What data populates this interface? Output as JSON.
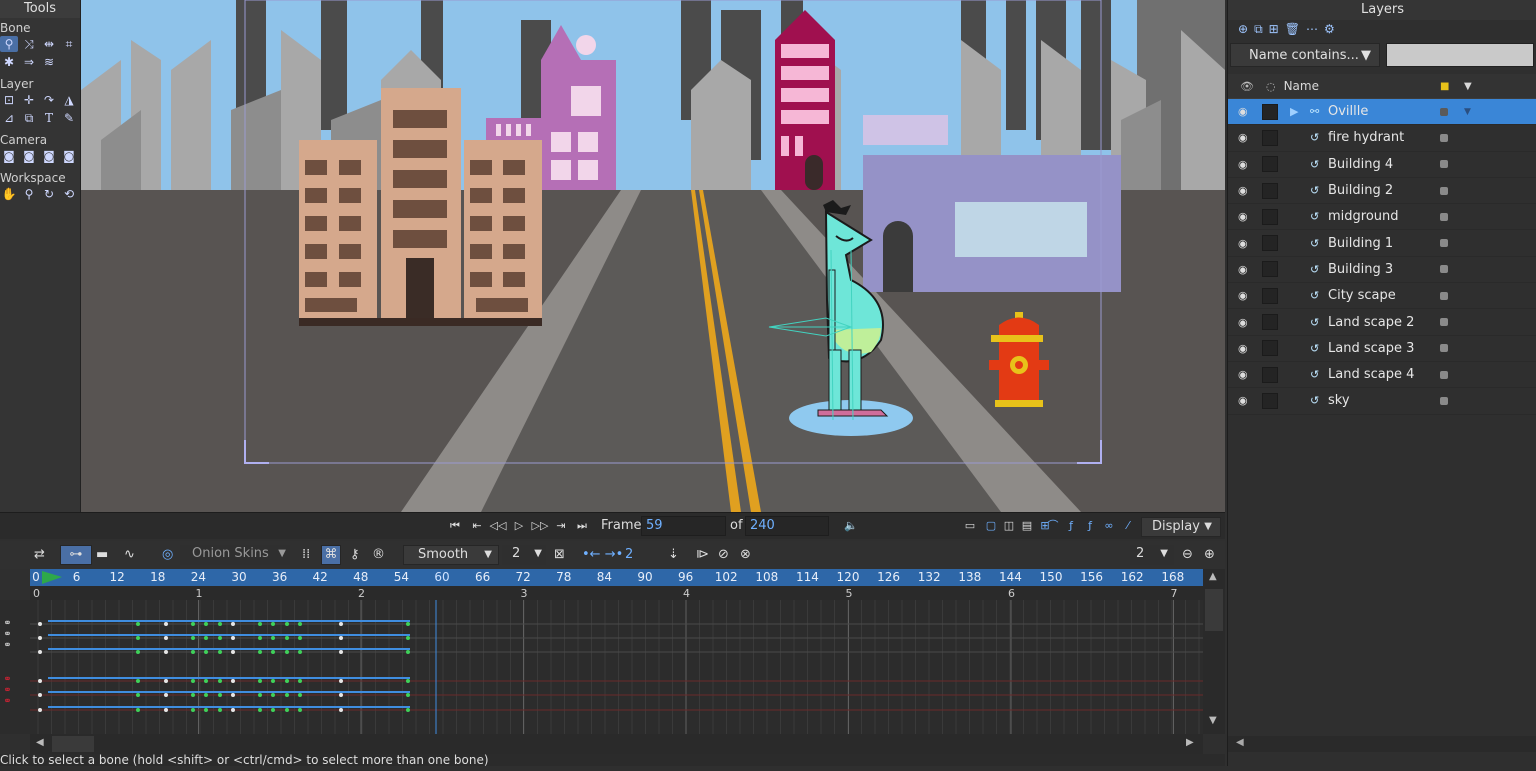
{
  "tools": {
    "title": "Tools",
    "sections": [
      "Bone",
      "Layer",
      "Camera",
      "Workspace"
    ]
  },
  "layers_panel": {
    "title": "Layers",
    "filter_label": "Name contains...",
    "header_name": "Name",
    "items": [
      {
        "name": "Ovillle",
        "selected": true,
        "type": "bone"
      },
      {
        "name": "fire hydrant",
        "selected": false,
        "type": "vector"
      },
      {
        "name": "Building 4",
        "selected": false,
        "type": "vector"
      },
      {
        "name": "Building 2",
        "selected": false,
        "type": "vector"
      },
      {
        "name": "midground",
        "selected": false,
        "type": "vector"
      },
      {
        "name": "Building 1",
        "selected": false,
        "type": "vector"
      },
      {
        "name": "Building 3",
        "selected": false,
        "type": "vector"
      },
      {
        "name": "City scape",
        "selected": false,
        "type": "vector"
      },
      {
        "name": "Land scape 2",
        "selected": false,
        "type": "vector"
      },
      {
        "name": "Land scape 3",
        "selected": false,
        "type": "vector"
      },
      {
        "name": "Land scape 4",
        "selected": false,
        "type": "vector"
      },
      {
        "name": "sky",
        "selected": false,
        "type": "vector"
      }
    ]
  },
  "frame_bar": {
    "frame_label": "Frame",
    "frame_value": "59",
    "of_label": "of",
    "total_frames": "240",
    "display_label": "Display"
  },
  "timeline_toolbar": {
    "onion_skins": "Onion Skins",
    "interpolation": "Smooth",
    "interp_value": "2",
    "keys_value": "2",
    "zoom_value": "2"
  },
  "ruler": {
    "frames": [
      "0",
      "6",
      "12",
      "18",
      "24",
      "30",
      "36",
      "42",
      "48",
      "54",
      "60",
      "66",
      "72",
      "78",
      "84",
      "90",
      "96",
      "102",
      "108",
      "114",
      "120",
      "126",
      "132",
      "138",
      "144",
      "150",
      "156",
      "162",
      "168"
    ],
    "seconds": [
      "0",
      "1",
      "2",
      "3",
      "4",
      "5",
      "6",
      "7"
    ]
  },
  "status": {
    "text": "Click to select a bone (hold <shift> or <ctrl/cmd> to select more than one bone)"
  },
  "colors": {
    "accent": "#3a86d7",
    "ruler": "#2e67a8",
    "sky": "#8fc3ea"
  }
}
